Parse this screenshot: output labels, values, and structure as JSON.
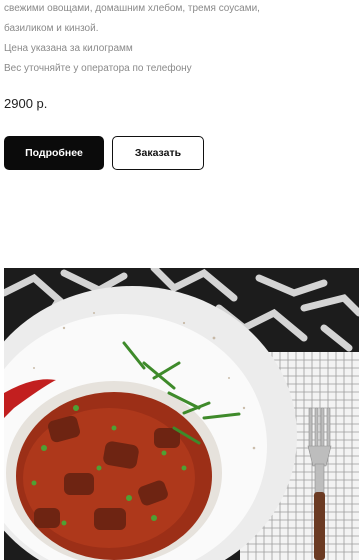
{
  "product": {
    "description_lines": [
      "свежими овощами, домашним хлебом, тремя соусами,",
      "базиликом и кинзой.",
      "Цена указана за килограмм",
      "Вес уточняйте у оператора по телефону"
    ],
    "price": "2900 р."
  },
  "buttons": {
    "details_label": "Подробнее",
    "order_label": "Заказать"
  },
  "image": {
    "icon": "dish-photo-icon"
  },
  "colors": {
    "primary_button_bg": "#0b0b0b",
    "secondary_text": "#8a8a8a"
  }
}
